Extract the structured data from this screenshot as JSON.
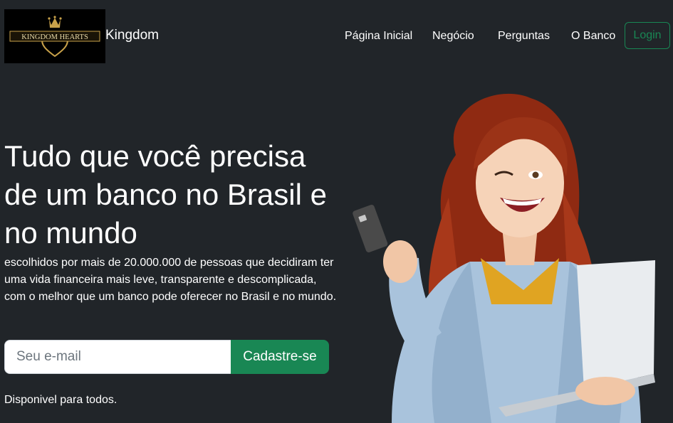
{
  "navbar": {
    "logo_text": "KINGDOM HEARTS",
    "brand": "Kingdom",
    "links": [
      "Página Inicial",
      "Negócio",
      "Perguntas",
      "O Banco"
    ],
    "login_label": "Login"
  },
  "hero": {
    "title": "Tudo que você precisa de um banco no Brasil e no mundo",
    "lead": "escolhidos por mais de 20.000.000 de pessoas que decidiram ter uma vida financeira mais leve, transparente e descomplicada, com o melhor que um banco pode oferecer no Brasil e no mundo.",
    "email_placeholder": "Seu e-mail",
    "signup_label": "Cadastre-se",
    "availability": "Disponivel para todos."
  },
  "colors": {
    "background": "#212529",
    "accent_green": "#198754",
    "text": "#ffffff"
  },
  "icons": {
    "logo": "kingdom-hearts-logo",
    "hero_image": "woman-with-card-and-laptop-photo"
  }
}
